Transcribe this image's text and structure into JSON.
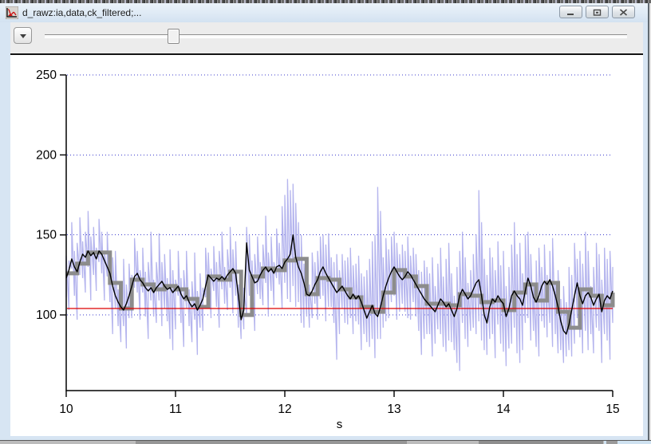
{
  "window": {
    "title": "d_rawz:ia,data,ck_filtered;...",
    "icon": "curve-plot-icon",
    "buttons": {
      "minimize": "minimize",
      "restore": "restore",
      "close": "close"
    }
  },
  "toolbar": {
    "dropdown_icon": "triangle-down",
    "slider": {
      "fraction": 0.215
    }
  },
  "chart_data": {
    "type": "line",
    "title": "",
    "xlabel": "s",
    "ylabel": "",
    "xlim": [
      10,
      15
    ],
    "ylim": [
      52.7,
      250
    ],
    "x_ticks": [
      10,
      11,
      12,
      13,
      14,
      15
    ],
    "y_ticks": [
      100,
      150,
      200,
      250
    ],
    "grid": "horizontal-dotted",
    "grid_color": "#3d3dcd",
    "threshold_line": {
      "value": 104,
      "color": "#dd0000"
    },
    "series": [
      {
        "name": "raw",
        "style": "hilo",
        "color": "#b5b5ee",
        "t0": 10,
        "dt": 0.025,
        "lo": [
          111,
          103,
          129,
          112,
          97,
          125,
          123,
          114,
          130,
          109,
          125,
          115,
          133,
          126,
          109,
          124,
          108,
          88,
          104,
          93,
          83,
          93,
          79,
          98,
          98,
          117,
          114,
          97,
          114,
          99,
          85,
          109,
          99,
          95,
          109,
          93,
          104,
          96,
          85,
          78,
          91,
          112,
          95,
          80,
          104,
          93,
          83,
          97,
          75,
          92,
          90,
          111,
          113,
          98,
          115,
          105,
          92,
          116,
          107,
          103,
          117,
          101,
          112,
          92,
          85,
          91,
          100,
          112,
          106,
          90,
          113,
          110,
          106,
          120,
          99,
          115,
          106,
          123,
          119,
          104,
          120,
          110,
          108,
          118,
          105,
          108,
          95,
          92,
          99,
          92,
          98,
          107,
          97,
          110,
          112,
          96,
          105,
          105,
          95,
          72,
          88,
          104,
          95,
          94,
          98,
          88,
          96,
          94,
          78,
          88,
          83,
          80,
          85,
          73,
          85,
          85,
          92,
          96,
          98,
          108,
          112,
          97,
          102,
          107,
          102,
          98,
          97,
          108,
          99,
          90,
          75,
          85,
          88,
          88,
          74,
          82,
          91,
          88,
          80,
          77,
          84,
          83,
          78,
          70,
          65,
          95,
          85,
          80,
          90,
          92,
          88,
          96,
          84,
          78,
          75,
          85,
          88,
          73,
          94,
          82,
          77,
          68,
          79,
          82,
          92,
          76,
          70,
          78,
          95,
          98,
          84,
          90,
          80,
          74,
          96,
          92,
          86,
          95,
          80,
          88,
          76,
          78,
          70,
          74,
          78,
          74,
          82,
          98,
          86,
          76,
          90,
          78,
          88,
          76,
          92,
          90,
          70,
          88,
          84,
          72,
          95
        ],
        "hi": [
          137,
          134,
          158,
          140,
          145,
          161,
          146,
          152,
          165,
          149,
          155,
          142,
          160,
          152,
          140,
          152,
          136,
          136,
          140,
          116,
          121,
          135,
          119,
          132,
          125,
          148,
          140,
          128,
          142,
          127,
          133,
          152,
          122,
          133,
          151,
          133,
          138,
          123,
          141,
          128,
          122,
          140,
          123,
          128,
          140,
          116,
          121,
          139,
          115,
          126,
          117,
          142,
          139,
          129,
          143,
          133,
          140,
          152,
          130,
          141,
          155,
          141,
          146,
          119,
          121,
          117,
          155,
          150,
          134,
          138,
          149,
          133,
          144,
          162,
          139,
          149,
          133,
          154,
          145,
          168,
          175,
          185,
          178,
          182,
          170,
          158,
          150,
          132,
          133,
          119,
          139,
          133,
          140,
          149,
          150,
          144,
          151,
          136,
          133,
          138,
          128,
          138,
          134,
          136,
          142,
          131,
          132,
          137,
          126,
          124,
          128,
          135,
          146,
          150,
          180,
          165,
          136,
          148,
          141,
          149,
          152,
          145,
          138,
          144,
          140,
          149,
          137,
          142,
          138,
          128,
          127,
          134,
          130,
          126,
          136,
          118,
          132,
          142,
          124,
          135,
          145,
          126,
          112,
          130,
          140,
          152,
          136,
          120,
          128,
          138,
          150,
          178,
          158,
          135,
          125,
          142,
          136,
          128,
          146,
          131,
          140,
          118,
          130,
          144,
          158,
          138,
          145,
          126,
          150,
          152,
          138,
          120,
          134,
          142,
          130,
          144,
          125,
          140,
          148,
          120,
          128,
          110,
          118,
          108,
          130,
          125,
          145,
          135,
          140,
          132,
          152,
          140,
          118,
          130,
          145,
          138,
          122,
          142,
          135,
          140,
          130
        ]
      },
      {
        "name": "ck_filtered",
        "style": "step",
        "color": "#8c8c8c",
        "stroke_width": 5,
        "t0": 10,
        "dt": 0.1,
        "values": [
          126,
          132,
          139,
          139,
          120,
          104,
          122,
          119,
          116,
          118,
          116,
          110,
          105,
          124,
          122,
          127,
          100,
          124,
          129,
          128,
          134,
          135,
          113,
          123,
          122,
          116,
          111,
          105,
          102,
          114,
          128,
          124,
          118,
          107,
          107,
          106,
          113,
          112,
          108,
          109,
          103,
          114,
          119,
          109,
          120,
          102,
          92,
          116,
          112,
          106,
          114
        ]
      },
      {
        "name": "data",
        "style": "line",
        "color": "#000000",
        "stroke_width": 1.4,
        "t0": 10,
        "dt": 0.025,
        "values": [
          123,
          128,
          135,
          130,
          127,
          133,
          138,
          136,
          140,
          137,
          139,
          135,
          140,
          138,
          134,
          130,
          126,
          118,
          112,
          108,
          105,
          103,
          107,
          112,
          118,
          124,
          126,
          122,
          120,
          117,
          115,
          117,
          114,
          117,
          119,
          121,
          118,
          116,
          117,
          114,
          116,
          118,
          113,
          110,
          112,
          108,
          105,
          107,
          103,
          106,
          110,
          118,
          125,
          123,
          121,
          123,
          122,
          124,
          122,
          125,
          127,
          129,
          126,
          112,
          97,
          103,
          145,
          128,
          124,
          120,
          121,
          125,
          128,
          130,
          127,
          129,
          126,
          130,
          131,
          129,
          133,
          135,
          138,
          150,
          136,
          130,
          126,
          120,
          113,
          112,
          115,
          119,
          122,
          127,
          130,
          126,
          123,
          120,
          117,
          114,
          116,
          118,
          115,
          112,
          110,
          113,
          110,
          112,
          108,
          103,
          98,
          102,
          106,
          101,
          99,
          105,
          112,
          118,
          123,
          127,
          130,
          127,
          124,
          122,
          124,
          127,
          125,
          122,
          119,
          116,
          113,
          110,
          108,
          106,
          104,
          102,
          106,
          110,
          108,
          105,
          107,
          103,
          99,
          104,
          112,
          116,
          113,
          110,
          112,
          116,
          120,
          122,
          112,
          100,
          95,
          105,
          110,
          108,
          112,
          109,
          107,
          99,
          104,
          112,
          115,
          112,
          110,
          106,
          115,
          123,
          118,
          111,
          108,
          112,
          118,
          121,
          119,
          122,
          118,
          112,
          105,
          96,
          90,
          88,
          94,
          103,
          112,
          120,
          112,
          107,
          112,
          114,
          111,
          106,
          110,
          113,
          102,
          109,
          112,
          110,
          115
        ]
      }
    ]
  }
}
